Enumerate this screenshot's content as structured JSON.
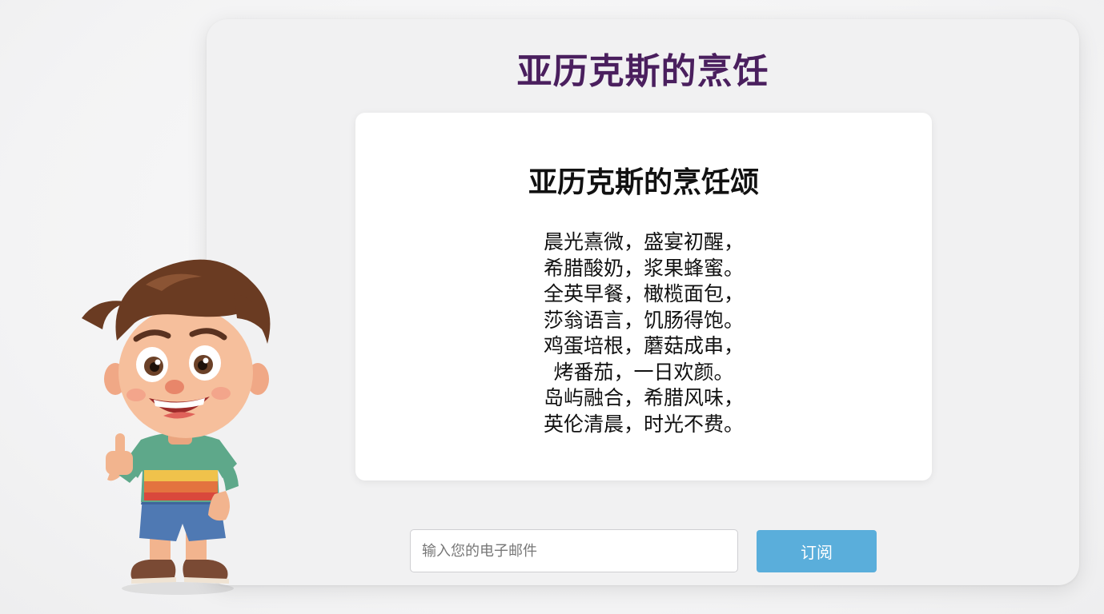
{
  "header": {
    "site_title": "亚历克斯的烹饪"
  },
  "poem": {
    "title": "亚历克斯的烹饪颂",
    "lines": [
      "晨光熹微，盛宴初醒，",
      "希腊酸奶，浆果蜂蜜。",
      "全英早餐，橄榄面包，",
      "莎翁语言，饥肠得饱。",
      "鸡蛋培根，蘑菇成串，",
      "烤番茄，一日欢颜。",
      "岛屿融合，希腊风味，",
      "英伦清晨，时光不费。"
    ]
  },
  "subscribe": {
    "email_placeholder": "输入您的电子邮件",
    "email_value": "",
    "button_label": "订阅"
  },
  "colors": {
    "title_color": "#4a1f5e",
    "button_color": "#5aaedb"
  },
  "mascot": {
    "icon": "cartoon-boy-thumbs-up-icon"
  }
}
